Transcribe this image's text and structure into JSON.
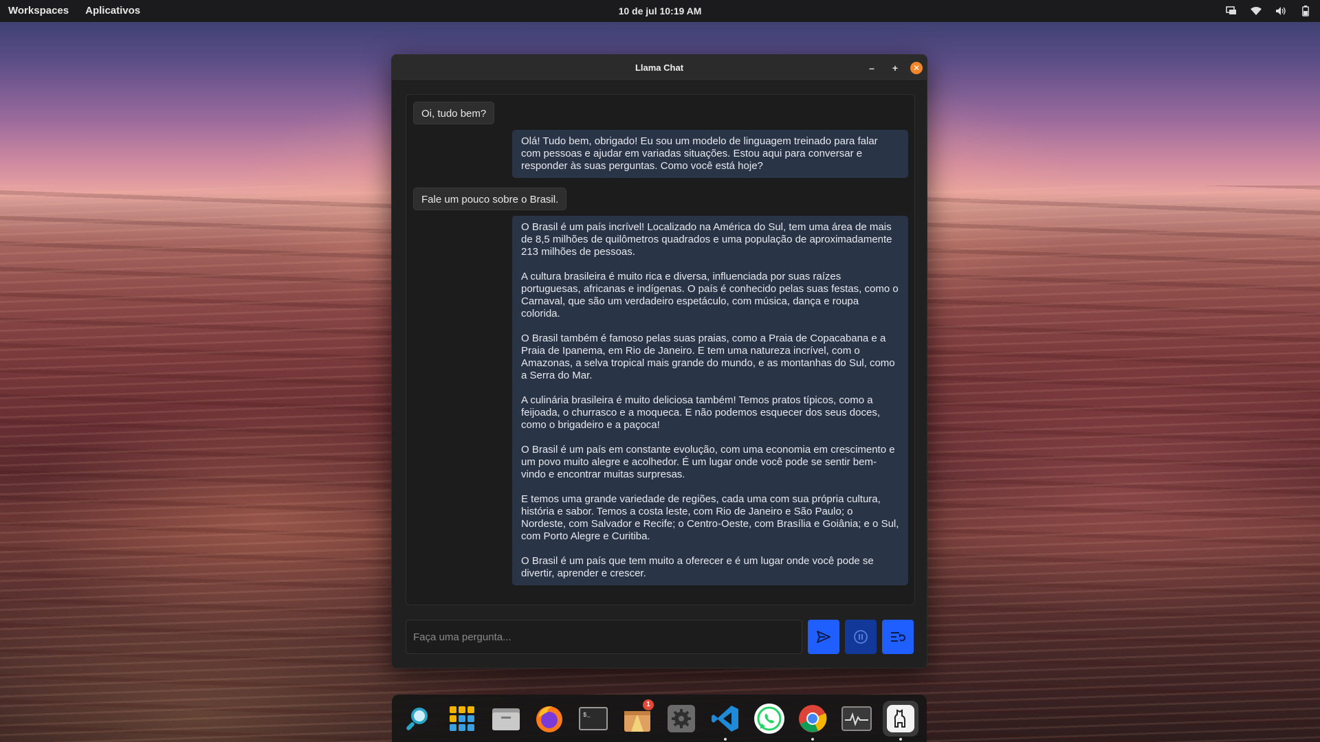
{
  "topbar": {
    "workspaces": "Workspaces",
    "apps": "Aplicativos",
    "clock": "10 de jul  10:19 AM",
    "icons": [
      "display-icon",
      "wifi-icon",
      "volume-icon",
      "battery-icon"
    ]
  },
  "window": {
    "title": "Llama Chat",
    "minimize": "–",
    "maximize": "+",
    "close": "✕"
  },
  "messages": [
    {
      "role": "user",
      "text": "Oi, tudo bem?"
    },
    {
      "role": "bot",
      "paragraphs": [
        "Olá! Tudo bem, obrigado! Eu sou um modelo de linguagem treinado para falar com pessoas e ajudar em variadas situações. Estou aqui para conversar e responder às suas perguntas. Como você está hoje?"
      ]
    },
    {
      "role": "user",
      "text": "Fale um pouco sobre o Brasil."
    },
    {
      "role": "bot",
      "paragraphs": [
        "O Brasil é um país incrível! Localizado na América do Sul, tem uma área de mais de 8,5 milhões de quilômetros quadrados e uma população de aproximadamente 213 milhões de pessoas.",
        "A cultura brasileira é muito rica e diversa, influenciada por suas raízes portuguesas, africanas e indígenas. O país é conhecido pelas suas festas, como o Carnaval, que são um verdadeiro espetáculo, com música, dança e roupa colorida.",
        "O Brasil também é famoso pelas suas praias, como a Praia de Copacabana e a Praia de Ipanema, em Rio de Janeiro. E tem uma natureza incrível, com o Amazonas, a selva tropical mais grande do mundo, e as montanhas do Sul, como a Serra do Mar.",
        "A culinária brasileira é muito deliciosa também! Temos pratos típicos, como a feijoada, o churrasco e a moqueca. E não podemos esquecer dos seus doces, como o brigadeiro e a paçoca!",
        "O Brasil é um país em constante evolução, com uma economia em crescimento e um povo muito alegre e acolhedor. É um lugar onde você pode se sentir bem-vindo e encontrar muitas surpresas.",
        "E temos uma grande variedade de regiões, cada uma com sua própria cultura, história e sabor. Temos a costa leste, com Rio de Janeiro e São Paulo; o Nordeste, com Salvador e Recife; o Centro-Oeste, com Brasília e Goiânia; e o Sul, com Porto Alegre e Curitiba.",
        "O Brasil é um país que tem muito a oferecer e é um lugar onde você pode se divertir, aprender e crescer."
      ]
    }
  ],
  "composer": {
    "placeholder": "Faça uma pergunta...",
    "value": ""
  },
  "dock": {
    "apps": [
      {
        "name": "search-app",
        "icon": "magnifier-icon"
      },
      {
        "name": "app-grid",
        "icon": "grid-icon"
      },
      {
        "name": "files",
        "icon": "folder-icon"
      },
      {
        "name": "firefox",
        "icon": "firefox-icon"
      },
      {
        "name": "terminal",
        "icon": "terminal-icon"
      },
      {
        "name": "software-store",
        "icon": "store-icon",
        "badge": "1"
      },
      {
        "name": "settings",
        "icon": "gear-icon"
      },
      {
        "name": "vscode",
        "icon": "vscode-icon"
      },
      {
        "name": "whatsapp",
        "icon": "whatsapp-icon"
      },
      {
        "name": "chrome",
        "icon": "chrome-icon"
      },
      {
        "name": "system-monitor",
        "icon": "monitor-icon"
      },
      {
        "name": "llama-chat",
        "icon": "llama-icon"
      }
    ]
  },
  "colors": {
    "accent": "#1f5fff",
    "bot_bubble": "#2a3447",
    "close_button": "#f3862a"
  }
}
